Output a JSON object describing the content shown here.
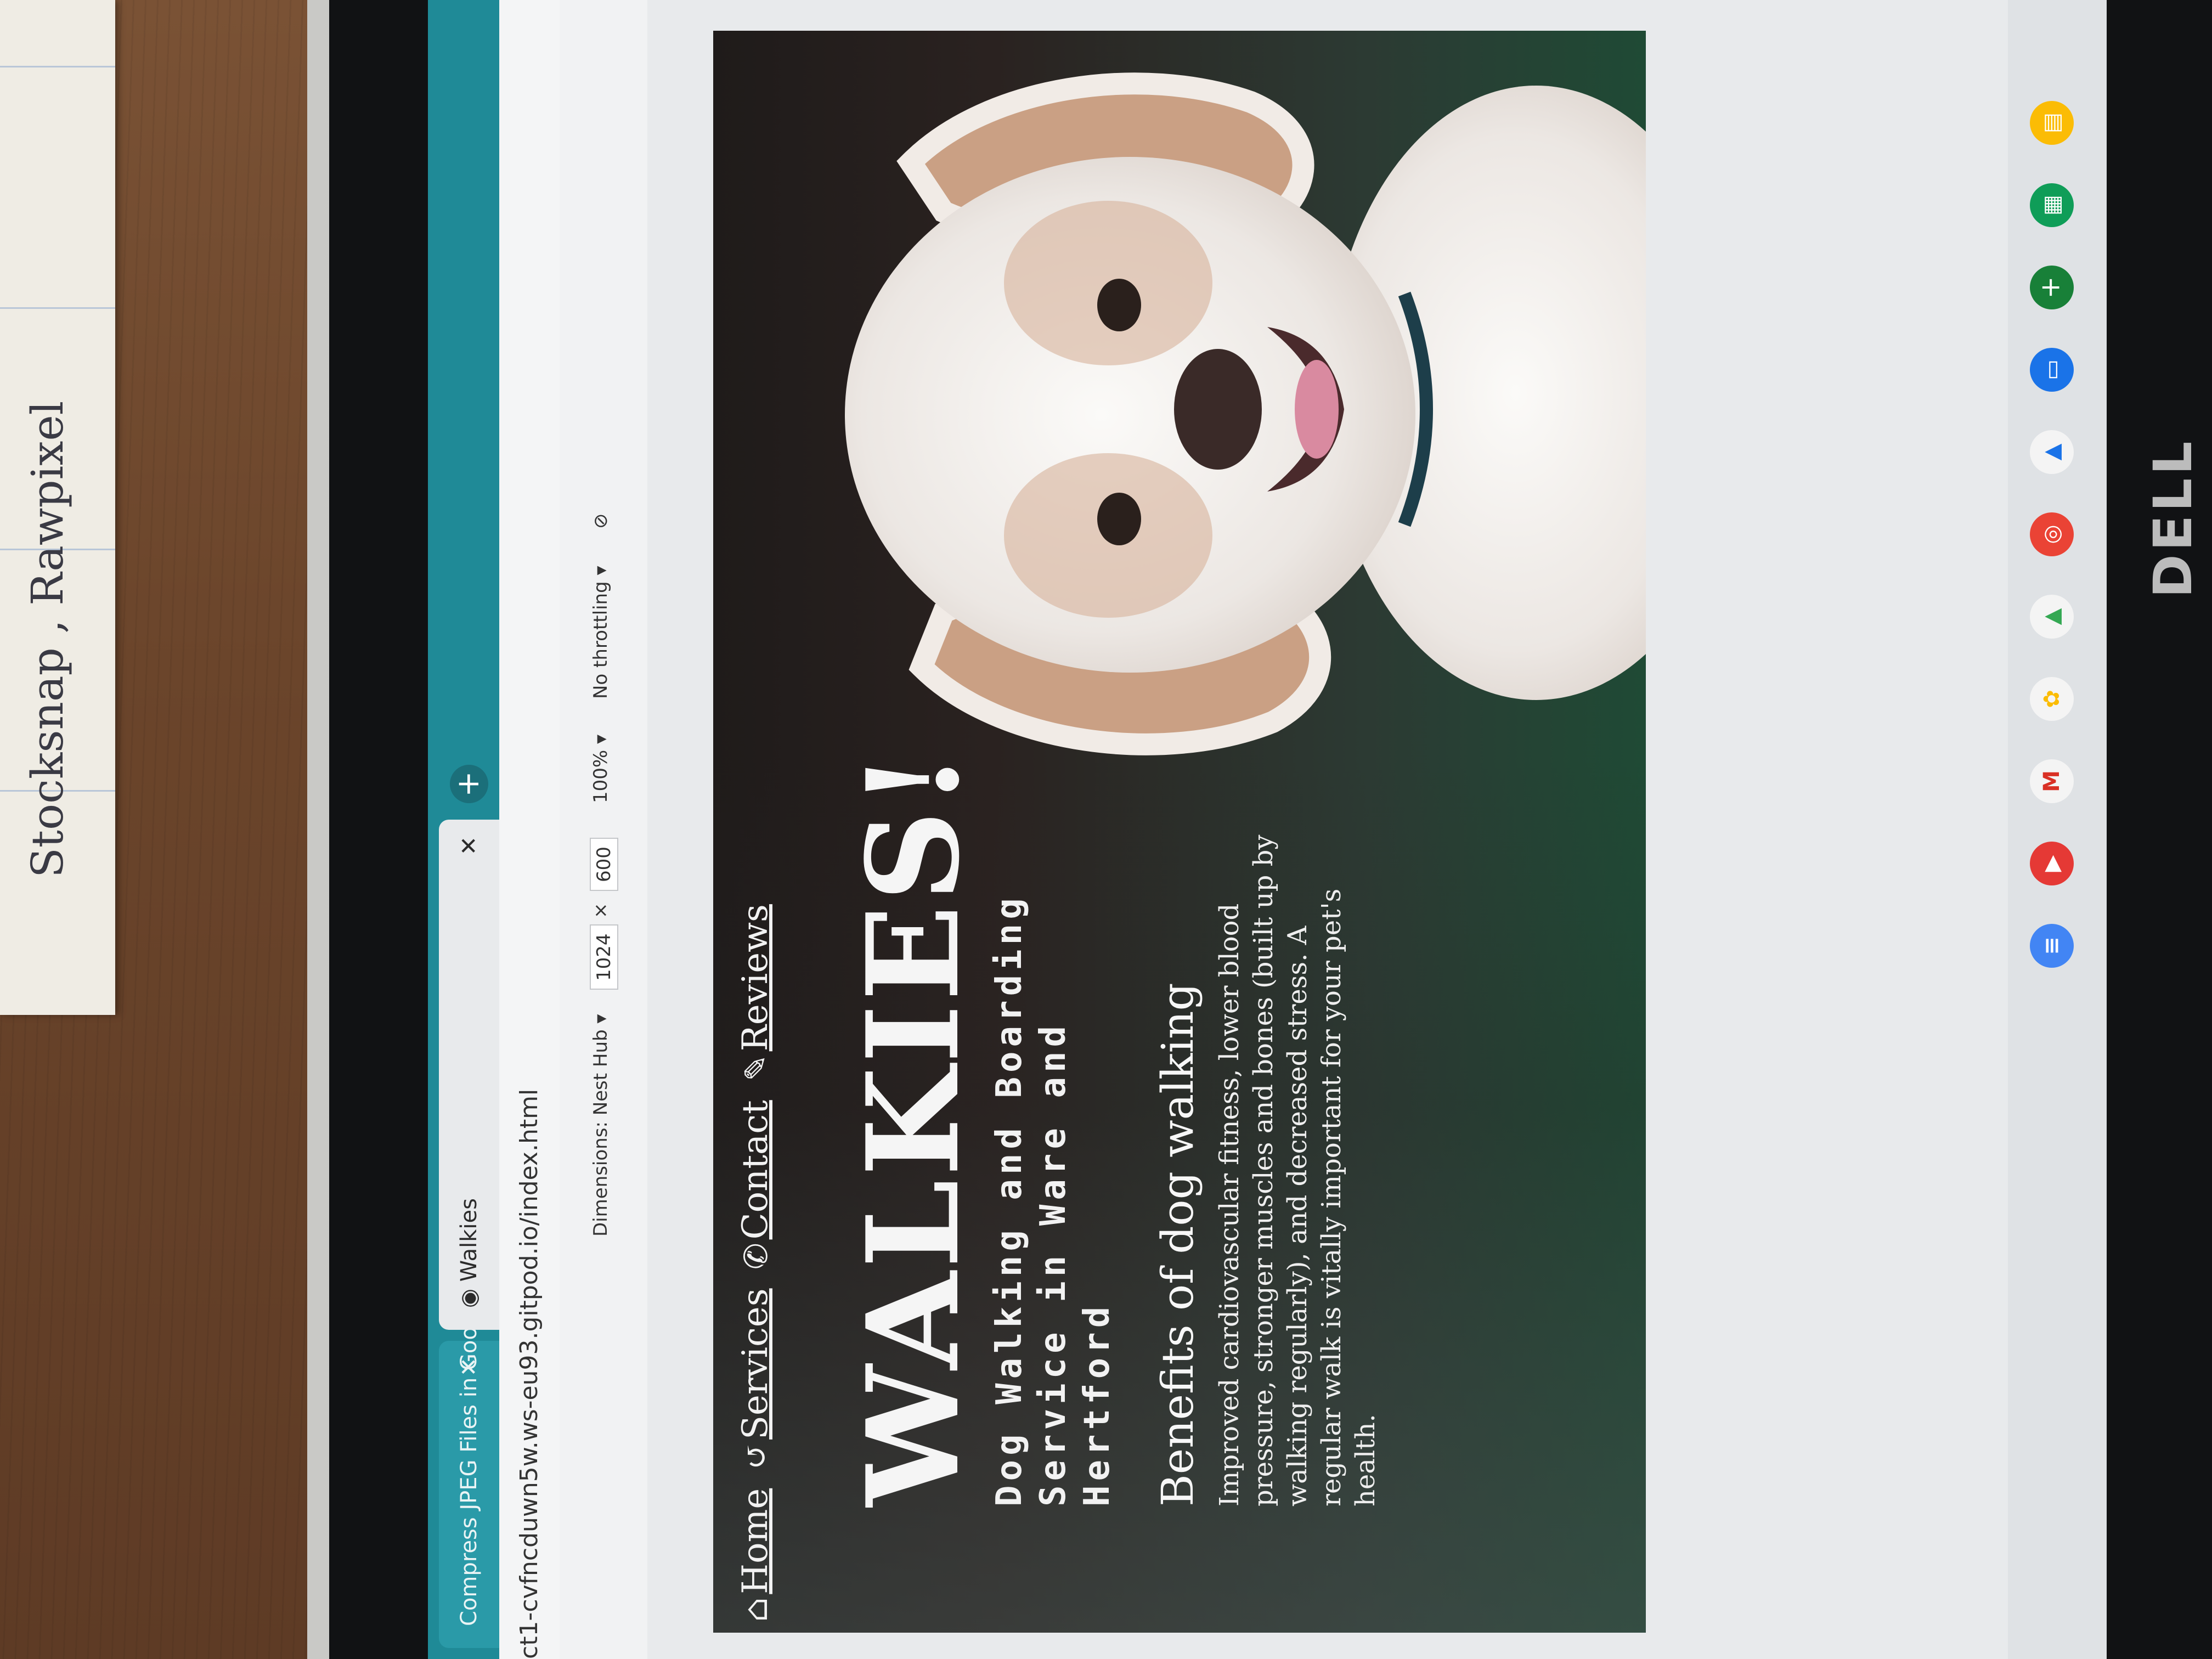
{
  "paper_note": {
    "text": "Stocksnap , Rawpixel"
  },
  "monitor": {
    "brand": "DELL"
  },
  "browser": {
    "tabs": [
      {
        "label": "Compress JPEG Files in Google",
        "active": false
      },
      {
        "label": "Walkies",
        "active": true
      }
    ],
    "close_glyph": "✕",
    "new_tab_glyph": "+",
    "url": "ct1-cvfncduwn5w.ws-eu93.gitpod.io/index.html"
  },
  "devtools": {
    "dimensions_label": "Dimensions: Nest Hub ▾",
    "width": "1024",
    "times": "×",
    "height": "600",
    "zoom": "100% ▾",
    "throttling": "No throttling ▾"
  },
  "site": {
    "nav": [
      {
        "label": "Home",
        "icon": "⌂"
      },
      {
        "label": "Services",
        "icon": "↺"
      },
      {
        "label": "Contact",
        "icon": "✆"
      },
      {
        "label": "Reviews",
        "icon": "✎"
      }
    ],
    "title": "WALKIES!",
    "subtitle": "Dog Walking and Boarding Service in Ware and Hertford",
    "benefits_heading": "Benefits of dog walking",
    "benefits_text": "Improved cardiovascular fitness, lower blood pressure, stronger muscles and bones (built up by walking regularly), and decreased stress. A regular walk is vitally important for your pet's health."
  },
  "shelf": {
    "icons": [
      "docs-icon",
      "youtube-icon",
      "gmail-icon",
      "photos-icon",
      "drive-icon",
      "chrome-icon",
      "play-icon",
      "files-icon",
      "calculator-icon",
      "sheets-icon",
      "calendar-icon"
    ],
    "colors": [
      "#4285f4",
      "#e53935",
      "#d93025",
      "#fbbc05",
      "#34a853",
      "#ea4335",
      "#1a73e8",
      "#1a73e8",
      "#188038",
      "#0f9d58",
      "#fbbc05"
    ]
  },
  "colors": {
    "tabbar": "#1f8a97",
    "page_bg_green": "#1f4a35",
    "dog_white": "#f0eeec",
    "dog_tan": "#c99a78"
  }
}
